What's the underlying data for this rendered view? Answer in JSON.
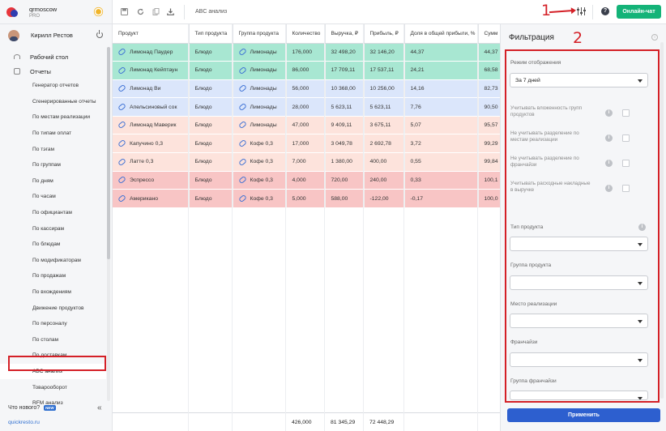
{
  "brand": {
    "name": "qrmoscow",
    "plan": "PRO"
  },
  "user": {
    "name": "Кирилл Рестов"
  },
  "nav_top": [
    {
      "label": "Рабочий стол"
    },
    {
      "label": "Отчеты"
    }
  ],
  "nav_reports": [
    "Генератор отчетов",
    "Сгенерированные отчеты",
    "По местам реализации",
    "По типам оплат",
    "По тэгам",
    "По группам",
    "По дням",
    "По часам",
    "По официантам",
    "По кассирам",
    "По блюдам",
    "По модификаторам",
    "По продажам",
    "По вхождениям",
    "Движение продуктов",
    "По персоналу",
    "По столам",
    "По доставкам",
    "ABC анализ",
    "Товарооборот",
    "RFM анализ"
  ],
  "nav_active_index": 18,
  "whats_new": {
    "label": "Что нового?",
    "badge": "NEW"
  },
  "site_link": "quickresto.ru",
  "topbar": {
    "title": "ABC анализ",
    "chat_button": "Онлайн-чат",
    "help": "?"
  },
  "annotations": {
    "one": "1",
    "two": "2"
  },
  "table": {
    "columns": [
      "Продукт",
      "Тип продукта",
      "Группа продукта",
      "Количество",
      "Выручка, ₽",
      "Прибыль, ₽",
      "Доля в общей прибыли, %",
      "Сумм"
    ],
    "rows": [
      {
        "product": "Лимонад Паудер",
        "type": "Блюдо",
        "group": "Лимонады",
        "qty": "176,000",
        "revenue": "32 498,20",
        "profit": "32 146,20",
        "share": "44,37",
        "cum": "44,37",
        "color": "#a8e7d2"
      },
      {
        "product": "Лимонад Кейптаун",
        "type": "Блюдо",
        "group": "Лимонады",
        "qty": "86,000",
        "revenue": "17 709,11",
        "profit": "17 537,11",
        "share": "24,21",
        "cum": "68,58",
        "color": "#a8e7d2"
      },
      {
        "product": "Лимонад Ви",
        "type": "Блюдо",
        "group": "Лимонады",
        "qty": "56,000",
        "revenue": "10 368,00",
        "profit": "10 256,00",
        "share": "14,16",
        "cum": "82,73",
        "color": "#dbe6fb"
      },
      {
        "product": "Апельсиновый сок",
        "type": "Блюдо",
        "group": "Лимонады",
        "qty": "28,000",
        "revenue": "5 623,11",
        "profit": "5 623,11",
        "share": "7,76",
        "cum": "90,50",
        "color": "#dbe6fb"
      },
      {
        "product": "Лимонад Маверик",
        "type": "Блюдо",
        "group": "Лимонады",
        "qty": "47,000",
        "revenue": "9 409,11",
        "profit": "3 675,11",
        "share": "5,07",
        "cum": "95,57",
        "color": "#fde3dc"
      },
      {
        "product": "Капучино 0,3",
        "type": "Блюдо",
        "group": "Кофе 0,3",
        "qty": "17,000",
        "revenue": "3 049,78",
        "profit": "2 692,78",
        "share": "3,72",
        "cum": "99,29",
        "color": "#fde3dc"
      },
      {
        "product": "Латте 0,3",
        "type": "Блюдо",
        "group": "Кофе 0,3",
        "qty": "7,000",
        "revenue": "1 380,00",
        "profit": "400,00",
        "share": "0,55",
        "cum": "99,84",
        "color": "#fde3dc"
      },
      {
        "product": "Эспрессо",
        "type": "Блюдо",
        "group": "Кофе 0,3",
        "qty": "4,000",
        "revenue": "720,00",
        "profit": "240,00",
        "share": "0,33",
        "cum": "100,1",
        "color": "#f8c5c5"
      },
      {
        "product": "Американо",
        "type": "Блюдо",
        "group": "Кофе 0,3",
        "qty": "5,000",
        "revenue": "588,00",
        "profit": "-122,00",
        "share": "-0,17",
        "cum": "100,0",
        "color": "#f8c5c5"
      }
    ],
    "totals": {
      "qty": "426,000",
      "revenue": "81 345,29",
      "profit": "72 448,29"
    }
  },
  "filter": {
    "title": "Фильтрация",
    "display_mode": {
      "label": "Режим отображения",
      "value": "За 7 дней"
    },
    "checks": [
      "Учитывать вложенность групп продуктов",
      "Не учитывать разделение по местам реализации",
      "Не учитывать разделение по франчайзи",
      "Учитывать расходные накладные в выручке"
    ],
    "selects": [
      {
        "label": "Тип продукта",
        "value": ""
      },
      {
        "label": "Группа продукта",
        "value": ""
      },
      {
        "label": "Место реализации",
        "value": ""
      },
      {
        "label": "Франчайзи",
        "value": ""
      },
      {
        "label": "Группа франчайзи",
        "value": ""
      }
    ],
    "apply_button": "Применить"
  }
}
